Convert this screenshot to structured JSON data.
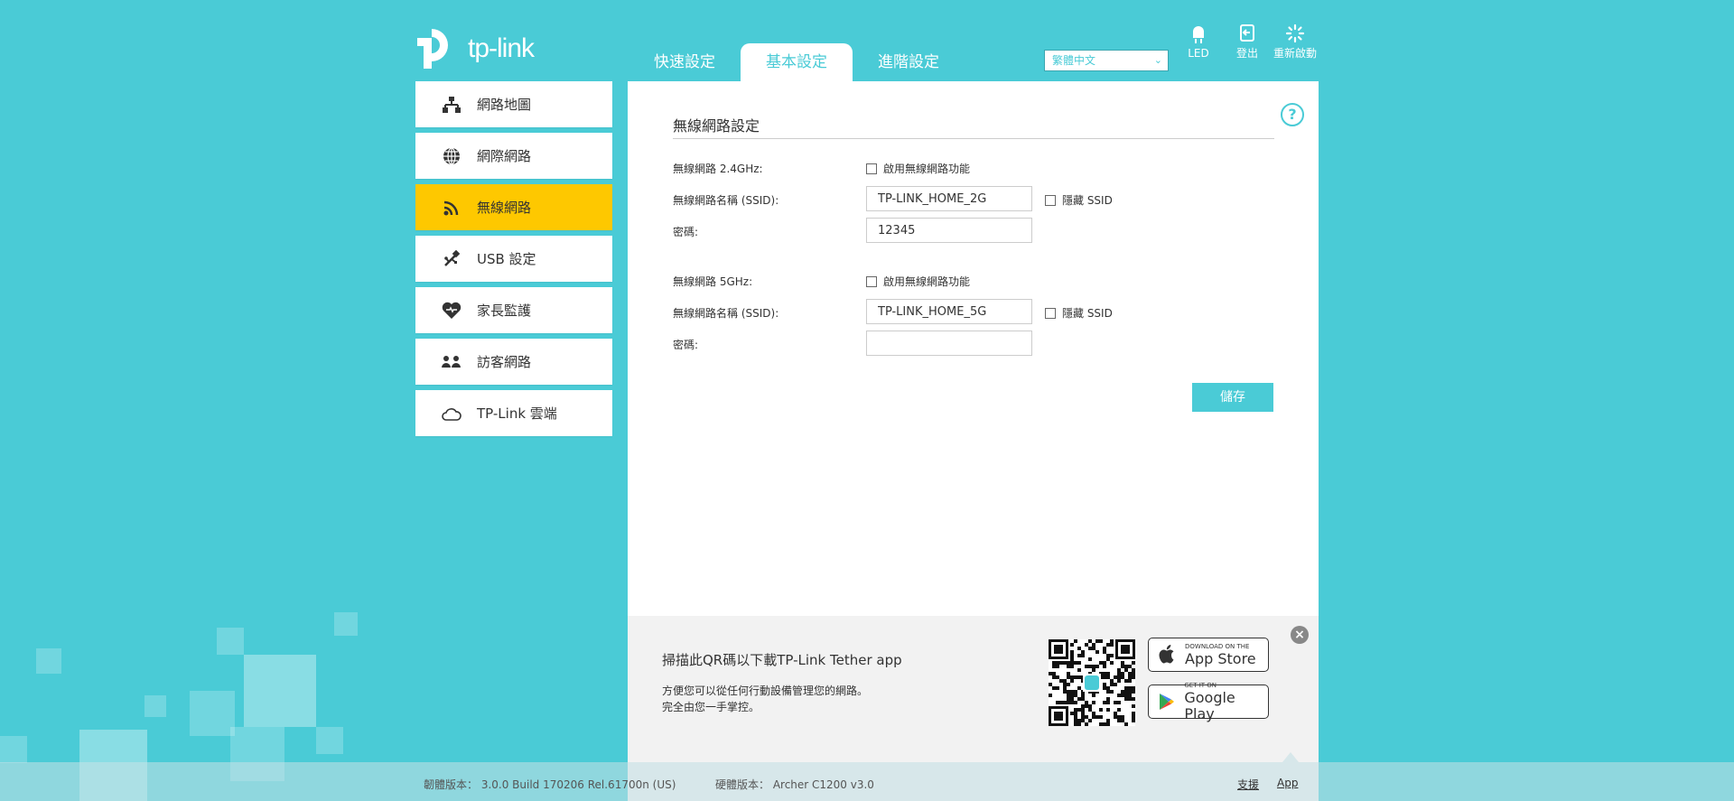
{
  "brand": {
    "logo_text": "tp-link"
  },
  "header": {
    "tabs": [
      {
        "label": "快速設定"
      },
      {
        "label": "基本設定"
      },
      {
        "label": "進階設定"
      }
    ],
    "language": "繁體中文",
    "led_label": "LED",
    "logout_label": "登出",
    "reboot_label": "重新啟動"
  },
  "sidebar": {
    "items": [
      {
        "label": "網路地圖",
        "icon": "network-map-icon"
      },
      {
        "label": "網際網路",
        "icon": "globe-icon"
      },
      {
        "label": "無線網路",
        "icon": "wifi-icon"
      },
      {
        "label": "USB 設定",
        "icon": "usb-icon"
      },
      {
        "label": "家長監護",
        "icon": "heart-icon"
      },
      {
        "label": "訪客網路",
        "icon": "guest-icon"
      },
      {
        "label": "TP-Link 雲端",
        "icon": "cloud-icon"
      }
    ]
  },
  "wireless": {
    "title": "無線網路設定",
    "band24": {
      "label": "無線網路 2.4GHz:",
      "enable_label": "啟用無線網路功能",
      "ssid_label": "無線網路名稱 (SSID):",
      "ssid_value": "TP-LINK_HOME_2G",
      "hide_label": "隱藏 SSID",
      "password_label": "密碼:",
      "password_value": "12345"
    },
    "band5": {
      "label": "無線網路 5GHz:",
      "enable_label": "啟用無線網路功能",
      "ssid_label": "無線網路名稱 (SSID):",
      "ssid_value": "TP-LINK_HOME_5G",
      "hide_label": "隱藏 SSID",
      "password_label": "密碼:",
      "password_value": ""
    },
    "save_label": "儲存"
  },
  "banner": {
    "title": "掃描此QR碼以下載TP-Link Tether app",
    "desc1": "方便您可以從任何行動設備管理您的網路。",
    "desc2": "完全由您一手掌控。",
    "appstore_small": "DOWNLOAD ON THE",
    "appstore_big": "App Store",
    "googleplay_small": "GET IT ON",
    "googleplay_big": "Google Play"
  },
  "footer": {
    "firmware": "韌體版本： 3.0.0 Build 170206 Rel.61700n (US)",
    "hardware": "硬體版本： Archer C1200 v3.0",
    "support_label": "支援",
    "app_label": "App"
  },
  "colors": {
    "accent": "#4acbd6",
    "active": "#fec800"
  }
}
